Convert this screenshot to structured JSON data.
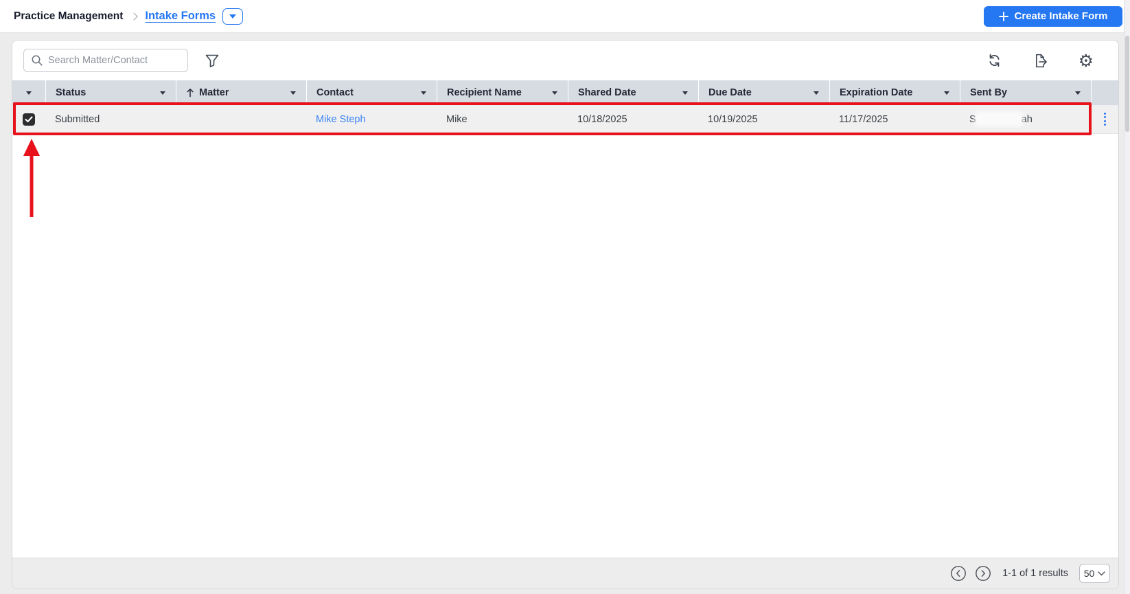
{
  "breadcrumb": {
    "parent": "Practice Management",
    "current": "Intake Forms"
  },
  "actions": {
    "create_button": "Create Intake Form"
  },
  "toolbar": {
    "search_placeholder": "Search Matter/Contact",
    "icons": [
      "filter-icon",
      "refresh-icon",
      "export-icon",
      "gear-icon"
    ]
  },
  "table": {
    "columns": {
      "status": "Status",
      "matter": "Matter",
      "contact": "Contact",
      "recipient": "Recipient Name",
      "shared": "Shared Date",
      "due": "Due Date",
      "expiration": "Expiration Date",
      "sent_by": "Sent By"
    },
    "sort": {
      "column": "Matter",
      "direction": "ascending"
    },
    "rows": [
      {
        "selected": true,
        "status": "Submitted",
        "matter": "",
        "contact": "Mike Steph",
        "recipient_name": "Mike",
        "shared_date": "10/18/2025",
        "due_date": "10/19/2025",
        "expiration_date": "11/17/2025",
        "sent_by_prefix": "S",
        "sent_by_redacted": true,
        "sent_by_suffix": "ah"
      }
    ]
  },
  "footer": {
    "results": "1-1 of 1 results",
    "page_size": "50"
  },
  "colors": {
    "accent_blue": "#2577f2",
    "link_blue": "#3c83f5",
    "header_bg": "#d7dce3",
    "selected_row_bg": "#f0f0f0",
    "annotation_red": "#e8121c",
    "checkbox_fill": "#2d2d2f"
  }
}
